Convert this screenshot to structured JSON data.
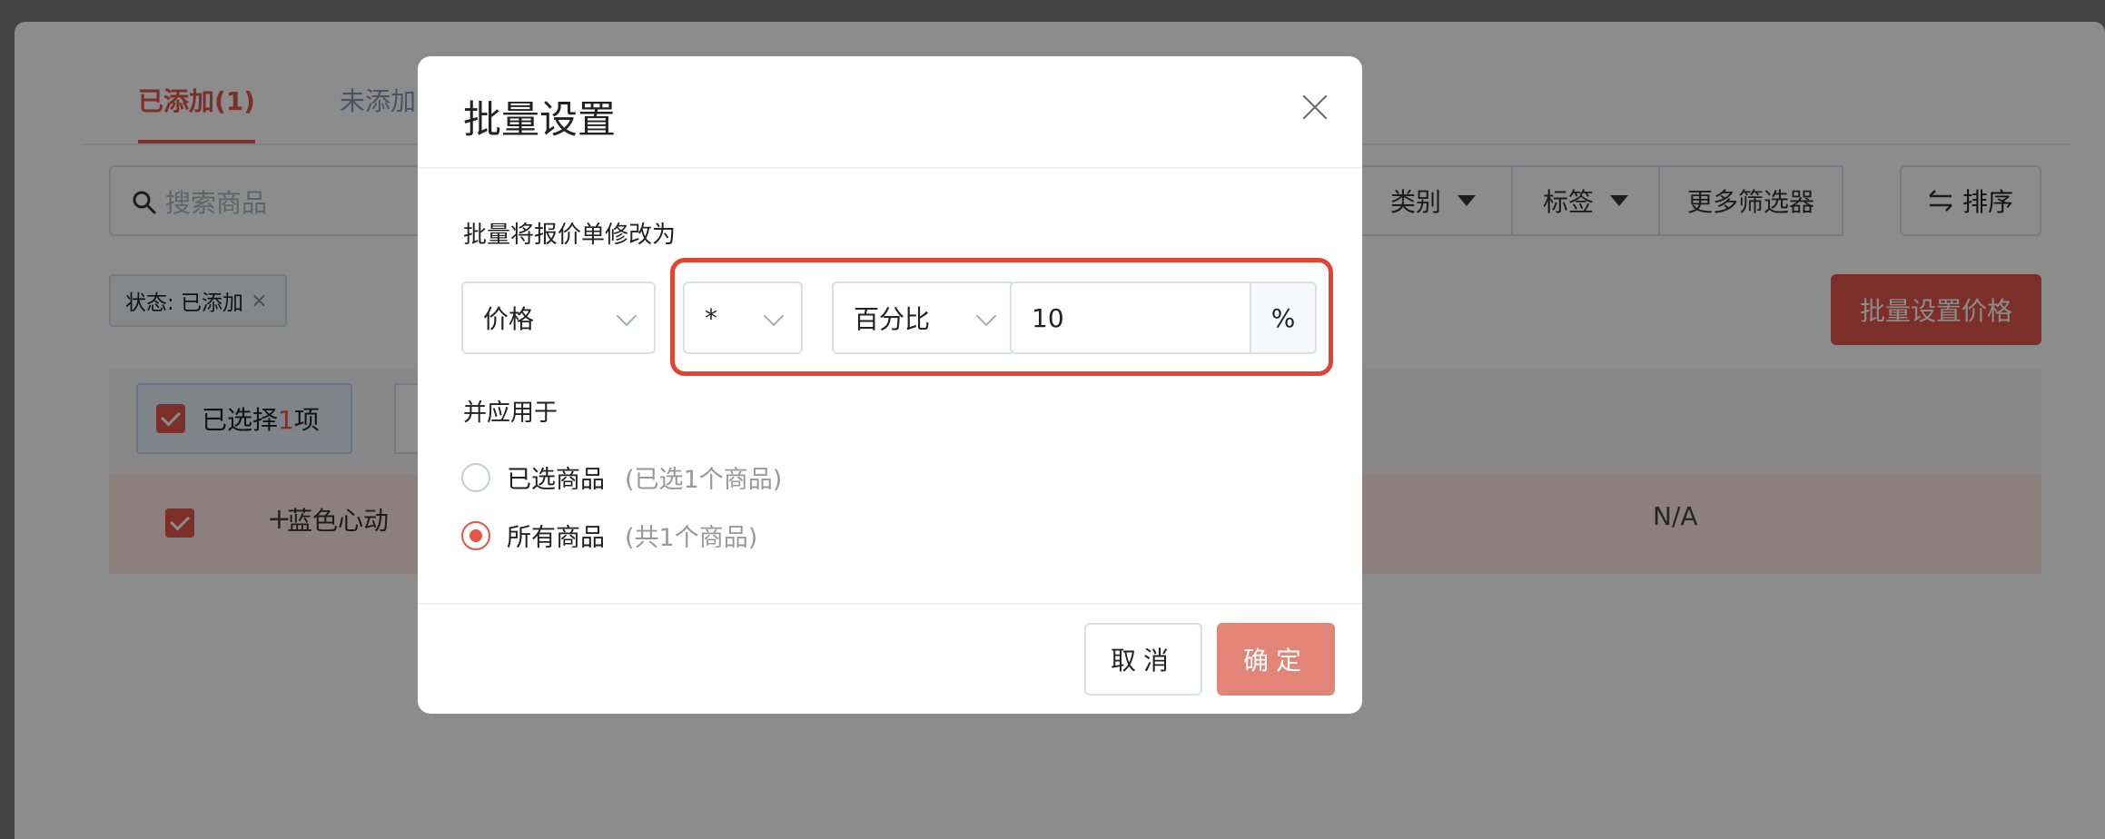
{
  "background": {
    "tabs": [
      {
        "label": "已添加(1)"
      },
      {
        "label": "未添加"
      }
    ],
    "search": {
      "placeholder": "搜索商品"
    },
    "filters": {
      "category_label": "类别",
      "tag_label": "标签",
      "more_label": "更多筛选器",
      "sort_label": "排序"
    },
    "status_chip": {
      "label": "状态: 已添加",
      "close": "×"
    },
    "batch_button_label": "批量设置价格",
    "selection": {
      "prefix": "已选择",
      "count": "1",
      "suffix": "项"
    },
    "row": {
      "plus": "+",
      "name": "蓝色心动",
      "value": "N/A"
    }
  },
  "modal": {
    "title": "批量设置",
    "label_modify": "批量将报价单修改为",
    "field_select": "价格",
    "operator_select": "*",
    "mode_select": "百分比",
    "value_input": "10",
    "value_suffix": "%",
    "label_apply": "并应用于",
    "options": [
      {
        "label": "已选商品",
        "note": "(已选1个商品)",
        "selected": false
      },
      {
        "label": "所有商品",
        "note": "(共1个商品)",
        "selected": true
      }
    ],
    "cancel_label": "取消",
    "ok_label": "确定"
  },
  "colors": {
    "accent": "#e0574a",
    "highlight": "#e04434",
    "ok_button": "#e38479"
  }
}
